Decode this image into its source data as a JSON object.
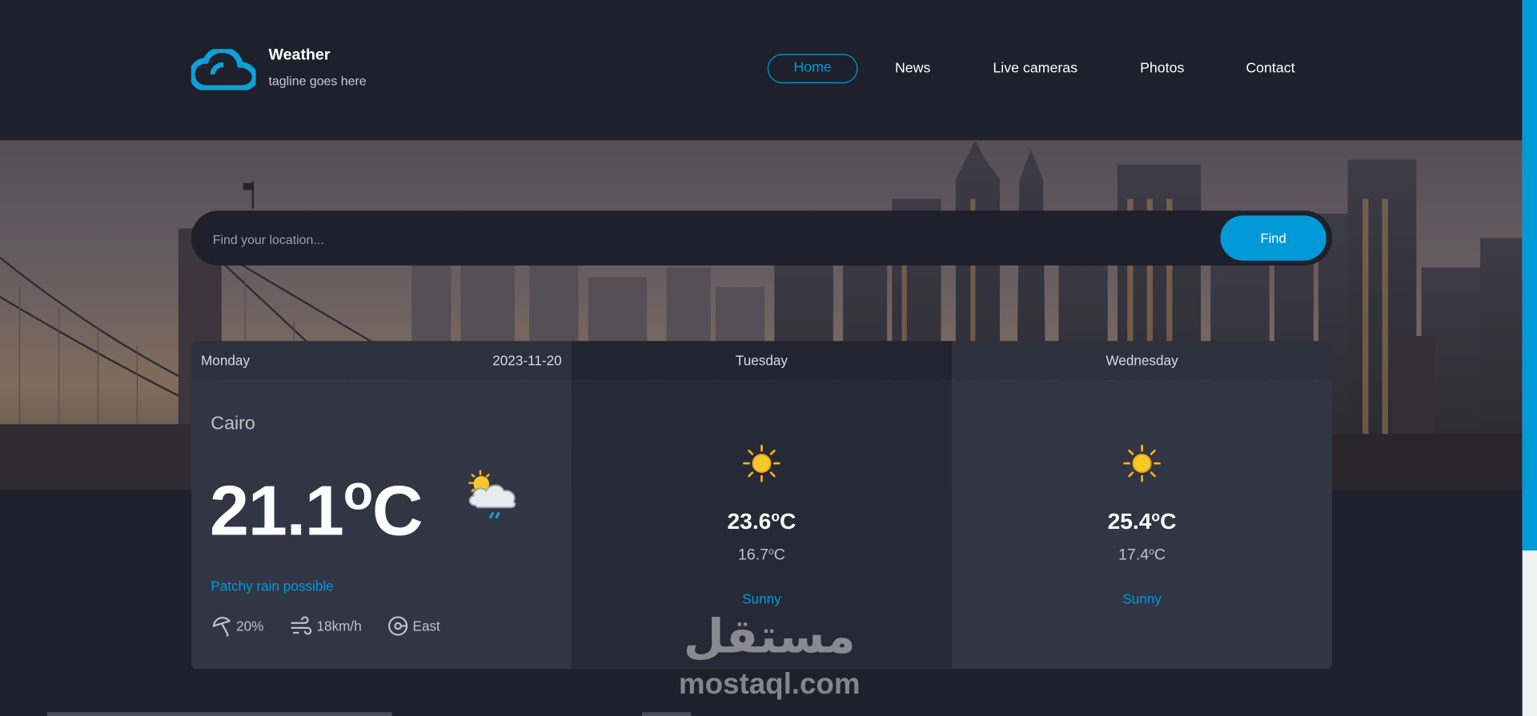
{
  "brand": {
    "title": "Weather",
    "tagline": "tagline goes here",
    "logo_icon": "cloud-icon",
    "accent": "#009ad8"
  },
  "nav": {
    "items": [
      {
        "label": "Home",
        "active": true
      },
      {
        "label": "News",
        "active": false
      },
      {
        "label": "Live cameras",
        "active": false
      },
      {
        "label": "Photos",
        "active": false
      },
      {
        "label": "Contact",
        "active": false
      }
    ]
  },
  "search": {
    "placeholder": "Find your location...",
    "button_label": "Find"
  },
  "today": {
    "day": "Monday",
    "date": "2023-11-20",
    "city": "Cairo",
    "temp_value": "21.1",
    "temp_degree": "o",
    "temp_unit": "C",
    "condition": "Patchy rain possible",
    "icon": "sun-cloud-rain-icon",
    "rain_chance": "20%",
    "wind_speed": "18km/h",
    "wind_direction": "East"
  },
  "forecast": [
    {
      "day": "Tuesday",
      "max_value": "23.6",
      "min_value": "16.7",
      "degree": "o",
      "unit": "C",
      "condition": "Sunny",
      "icon": "sun-icon"
    },
    {
      "day": "Wednesday",
      "max_value": "25.4",
      "min_value": "17.4",
      "degree": "o",
      "unit": "C",
      "condition": "Sunny",
      "icon": "sun-icon"
    }
  ],
  "watermark": {
    "arabic": "مستقل",
    "text": "mostaql.com"
  },
  "colors": {
    "background": "#1e202b",
    "accent": "#009ad8",
    "card_light": "#323544",
    "card_dark": "#262936"
  }
}
